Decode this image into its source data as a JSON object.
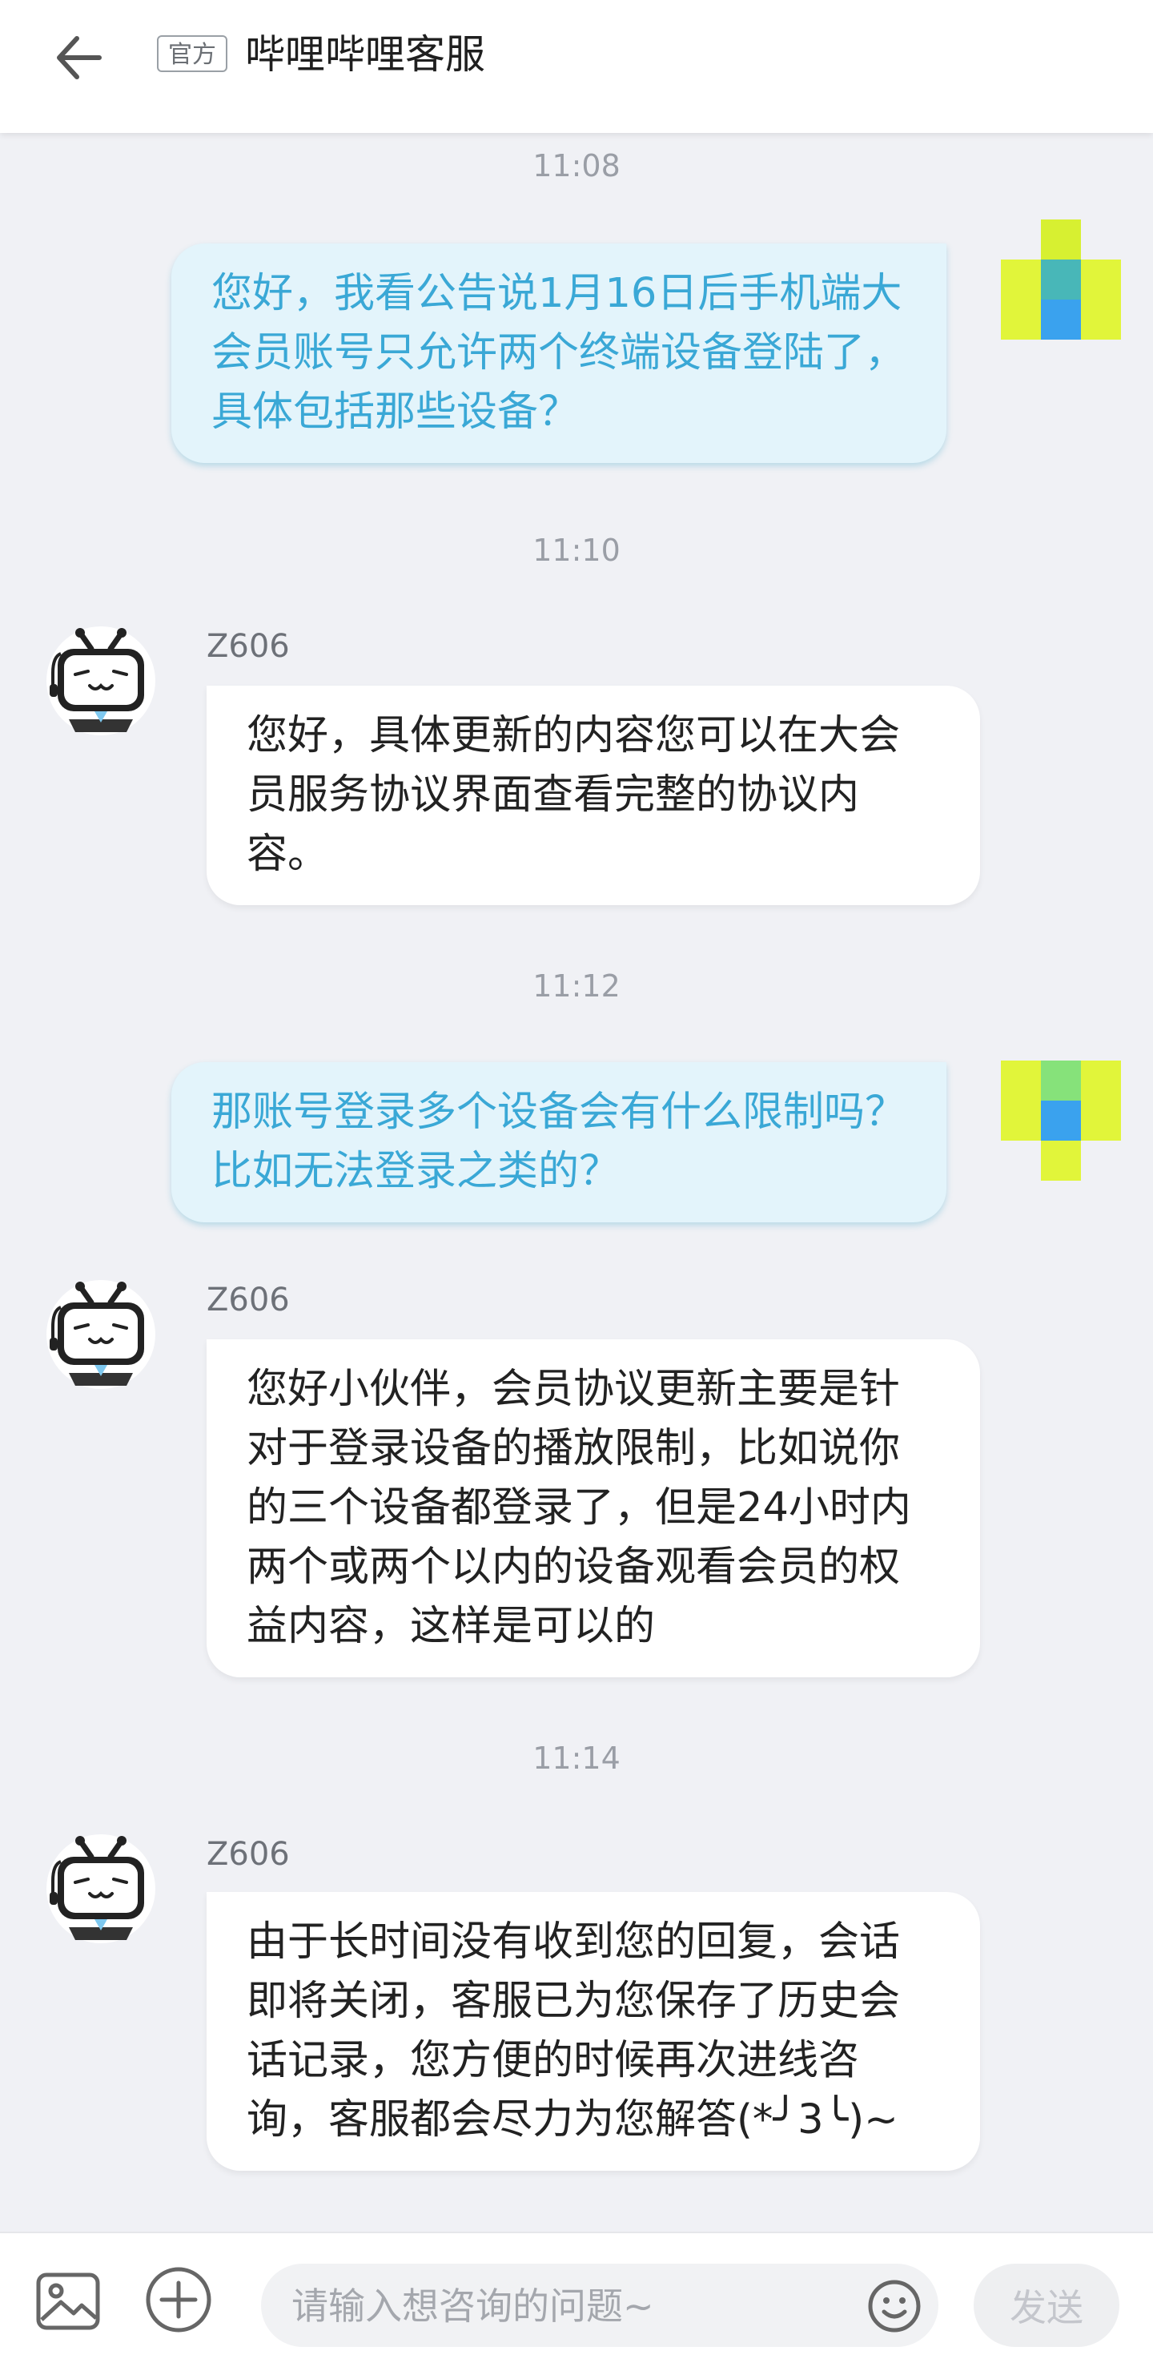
{
  "header": {
    "official_label": "官方",
    "title": "哔哩哔哩客服"
  },
  "messages": [
    {
      "type": "timestamp",
      "text": "11:08"
    },
    {
      "type": "user",
      "text": "您好，我看公告说1月16日后手机端大会员账号只允许两个终端设备登陆了，具体包括那些设备？"
    },
    {
      "type": "timestamp",
      "text": "11:10"
    },
    {
      "type": "agent",
      "name": "Z606",
      "text": "您好，具体更新的内容您可以在大会员服务协议界面查看完整的协议内容。"
    },
    {
      "type": "timestamp",
      "text": "11:12"
    },
    {
      "type": "user",
      "text": "那账号登录多个设备会有什么限制吗？比如无法登录之类的？"
    },
    {
      "type": "agent",
      "name": "Z606",
      "text": "您好小伙伴，会员协议更新主要是针对于登录设备的播放限制，比如说你的三个设备都登录了，但是24小时内两个或两个以内的设备观看会员的权益内容，这样是可以的"
    },
    {
      "type": "timestamp",
      "text": "11:14"
    },
    {
      "type": "agent",
      "name": "Z606",
      "text": "由于长时间没有收到您的回复，会话即将关闭，客服已为您保存了历史会话记录，您方便的时候再次进线咨询，客服都会尽力为您解答(*╯3╰)~"
    }
  ],
  "input": {
    "placeholder": "请输入想咨询的问题~",
    "value": "",
    "send_label": "发送"
  },
  "icons": {
    "back": "arrow-left-icon",
    "image": "image-icon",
    "plus": "plus-circle-icon",
    "emoji": "emoji-icon",
    "agent_avatar": "tv-robot-avatar-icon"
  },
  "colors": {
    "user_bubble_bg": "#e3f4fb",
    "user_text": "#3aa8d6",
    "agent_bubble_bg": "#ffffff",
    "page_bg": "#f0f1f5",
    "caret": "#fb7299"
  }
}
